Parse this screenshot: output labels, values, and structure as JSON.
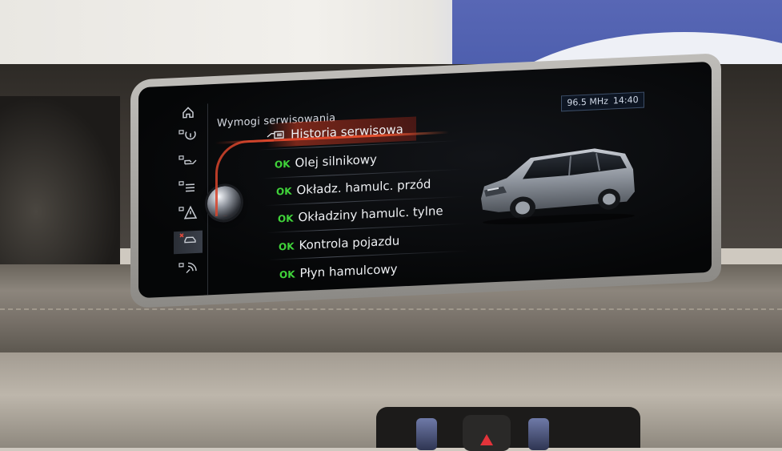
{
  "screen": {
    "title": "Wymogi serwisowania",
    "status": {
      "radio": "96.5 MHz",
      "time": "14:40"
    }
  },
  "side_rail": {
    "icons": [
      "home-icon",
      "tire-pressure-icon",
      "oil-can-icon",
      "brake-icon",
      "warning-triangle-icon",
      "car-service-icon",
      "connected-services-icon"
    ]
  },
  "menu": {
    "header_item": {
      "label": "Historia serwisowa",
      "icon": "service-history-icon"
    },
    "items": [
      {
        "status": "OK",
        "label": "Olej silnikowy"
      },
      {
        "status": "OK",
        "label": "Okładz. hamulc. przód"
      },
      {
        "status": "OK",
        "label": "Okładziny hamulc. tylne"
      },
      {
        "status": "OK",
        "label": "Kontrola pojazdu"
      },
      {
        "status": "OK",
        "label": "Płyn hamulcowy"
      }
    ]
  },
  "colors": {
    "ok": "#40d33a",
    "selection": "#e24a2e",
    "status_border": "#3c4d66"
  }
}
